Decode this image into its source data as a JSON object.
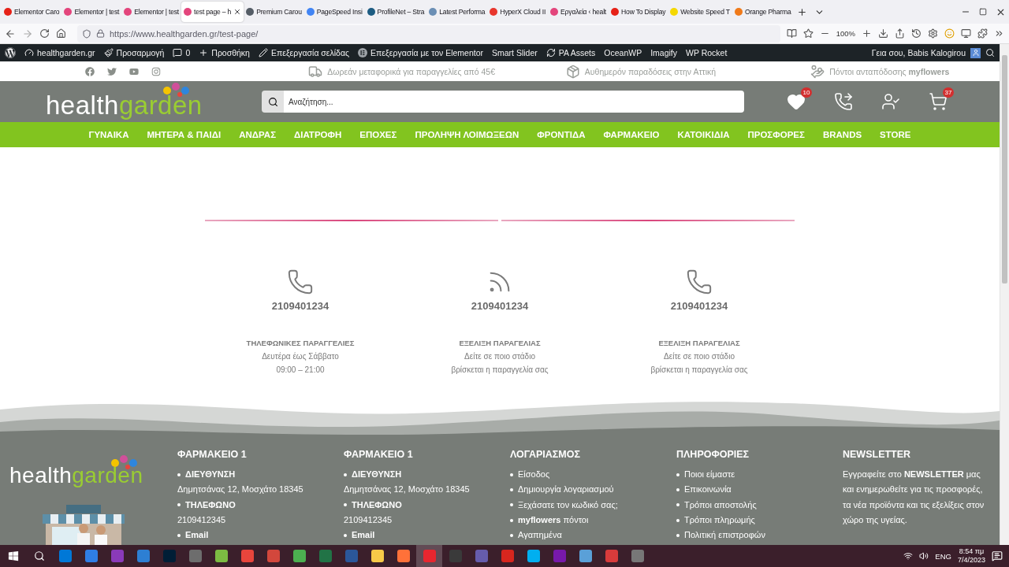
{
  "browser": {
    "tabs": [
      {
        "title": "Elementor Caro",
        "selected": false,
        "color": "#e62117"
      },
      {
        "title": "Elementor | test",
        "selected": false,
        "color": "#e3457c"
      },
      {
        "title": "Elementor | test",
        "selected": false,
        "color": "#e3457c"
      },
      {
        "title": "test page – h",
        "selected": true,
        "color": "#e3457c"
      },
      {
        "title": "Premium Carou",
        "selected": false,
        "color": "#555d66"
      },
      {
        "title": "PageSpeed Insi",
        "selected": false,
        "color": "#4285f4"
      },
      {
        "title": "ProfileNet – Stra",
        "selected": false,
        "color": "#1d5c82"
      },
      {
        "title": "Latest Performa",
        "selected": false,
        "color": "#6b8fb5"
      },
      {
        "title": "HyperX Cloud II",
        "selected": false,
        "color": "#e8362d"
      },
      {
        "title": "Εργαλεία ‹ healt",
        "selected": false,
        "color": "#e3457c"
      },
      {
        "title": "How To Display",
        "selected": false,
        "color": "#e62117"
      },
      {
        "title": "Website Speed T",
        "selected": false,
        "color": "#f5d800"
      },
      {
        "title": "Orange Pharma",
        "selected": false,
        "color": "#f07a1a"
      }
    ],
    "url": "https://www.healthgarden.gr/test-page/",
    "zoom": "100%"
  },
  "admin_bar": {
    "items": [
      {
        "kind": "site",
        "label": "healthgarden.gr"
      },
      {
        "kind": "customize",
        "label": "Προσαρμογή"
      },
      {
        "kind": "comments",
        "label": "0"
      },
      {
        "kind": "new",
        "label": "Προσθήκη"
      },
      {
        "kind": "edit",
        "label": "Επεξεργασία σελίδας"
      },
      {
        "kind": "elementor",
        "label": "Επεξεργασία με τον Elementor"
      },
      {
        "kind": "plain",
        "label": "Smart Slider"
      },
      {
        "kind": "assets",
        "label": "PA Assets"
      },
      {
        "kind": "plain",
        "label": "OceanWP"
      },
      {
        "kind": "plain",
        "label": "Imagify"
      },
      {
        "kind": "plain",
        "label": "WP Rocket"
      }
    ],
    "greeting": "Γεια σου, Babis Kalogirou"
  },
  "info_bar": {
    "items": [
      {
        "kind": "shipping",
        "text": "Δωρεάν μεταφορικά για παραγγελίες από 45€"
      },
      {
        "kind": "delivery",
        "text": "Αυθημερόν παραδόσεις στην Αττική"
      },
      {
        "kind": "points",
        "text": "Πόντοι ανταπόδοσης **myflowers**"
      }
    ]
  },
  "header": {
    "logo": {
      "first": "health",
      "second": "garden"
    },
    "search": {
      "placeholder": "Αναζήτηση..."
    },
    "wishlist_count": "10",
    "cart_count": "37"
  },
  "nav": {
    "items": [
      "ΓΥΝΑΙΚΑ",
      "ΜΗΤΕΡΑ & ΠΑΙΔΙ",
      "ΑΝΔΡΑΣ",
      "ΔΙΑΤΡΟΦΗ",
      "ΕΠΟΧΕΣ",
      "ΠΡΟΛΗΨΗ ΛΟΙΜΩΞΕΩΝ",
      "ΦΡΟΝΤΙΔΑ",
      "ΦΑΡΜΑΚΕΙΟ",
      "ΚΑΤΟΙΚΙΔΙΑ",
      "ΠΡΟΣΦΟΡΕΣ",
      "BRANDS",
      "STORE"
    ]
  },
  "contacts": [
    {
      "kind": "phone",
      "number": "2109401234",
      "title": "ΤΗΛΕΦΩΝΙΚΕΣ ΠΑΡΑΓΓΕΛΙΕΣ",
      "lines": [
        "Δευτέρα έως Σάββατο",
        "09:00 – 21:00"
      ]
    },
    {
      "kind": "feed",
      "number": "2109401234",
      "title": "ΕΞΕΛΙΞΗ ΠΑΡΑΓΕΛΙΑΣ",
      "lines": [
        "Δείτε σε ποιο στάδιο",
        "βρίσκεται η παραγγελία σας"
      ]
    },
    {
      "kind": "phone",
      "number": "2109401234",
      "title": "ΕΞΕΛΙΞΗ ΠΑΡΑΓΕΛΙΑΣ",
      "lines": [
        "Δείτε σε ποιο στάδιο",
        "βρίσκεται η παραγγελία σας"
      ]
    }
  ],
  "footer": {
    "logo": {
      "first": "health",
      "second": "garden"
    },
    "columns": [
      {
        "kind": "store",
        "title": "ΦΑΡΜΑΚΕΙΟ 1",
        "items": [
          {
            "label": "ΔΙΕΥΘΥΝΣΗ",
            "value": "Δημητσάνας 12, Μοσχάτο 18345"
          },
          {
            "label": "ΤΗΛΕΦΩΝΟ",
            "value": "2109412345"
          },
          {
            "label": "Email"
          }
        ]
      },
      {
        "kind": "store",
        "title": "ΦΑΡΜΑΚΕΙΟ 1",
        "items": [
          {
            "label": "ΔΙΕΥΘΥΝΣΗ",
            "value": "Δημητσάνας 12, Μοσχάτο 18345"
          },
          {
            "label": "ΤΗΛΕΦΩΝΟ",
            "value": "2109412345"
          },
          {
            "label": "Email"
          }
        ]
      },
      {
        "kind": "links",
        "title": "ΛΟΓΑΡΙΑΣΜΟΣ",
        "items": [
          {
            "label": "Είσοδος"
          },
          {
            "label": "Δημιουργία λογαριασμού"
          },
          {
            "label": "Ξεχάσατε τον κωδικό σας;"
          },
          {
            "label": "**myflowers** πόντοι"
          },
          {
            "label": "Αγαπημένα"
          }
        ]
      },
      {
        "kind": "links",
        "title": "ΠΛΗΡΟΦΟΡΙΕΣ",
        "items": [
          {
            "label": "Ποιοι είμαστε"
          },
          {
            "label": "Επικοινωνία"
          },
          {
            "label": "Τρόποι αποστολής"
          },
          {
            "label": "Τρόποι πληρωμής"
          },
          {
            "label": "Πολιτική επιστροφών"
          }
        ]
      },
      {
        "kind": "text",
        "title": "NEWSLETTER",
        "text": "Εγγραφείτε στο **NEWSLETTER** μας και ενημερωθείτε για τις προσφορές, τα νέα προϊόντα και τις εξελίξεις στον χώρο της υγείας."
      }
    ]
  },
  "taskbar": {
    "apps": [
      {
        "selected": false
      },
      {
        "selected": false
      },
      {
        "selected": false
      },
      {
        "selected": false
      },
      {
        "selected": false
      },
      {
        "selected": false
      },
      {
        "selected": false
      },
      {
        "selected": false
      },
      {
        "selected": false
      },
      {
        "selected": false
      },
      {
        "selected": false
      },
      {
        "selected": false
      },
      {
        "selected": false
      },
      {
        "selected": false
      },
      {
        "selected": true
      },
      {
        "selected": false
      },
      {
        "selected": false
      },
      {
        "selected": false
      },
      {
        "selected": false
      },
      {
        "selected": false
      },
      {
        "selected": false
      },
      {
        "selected": false
      },
      {
        "selected": false
      }
    ],
    "language": "ENG",
    "time": "8:54 πμ",
    "date": "7/4/2023"
  }
}
